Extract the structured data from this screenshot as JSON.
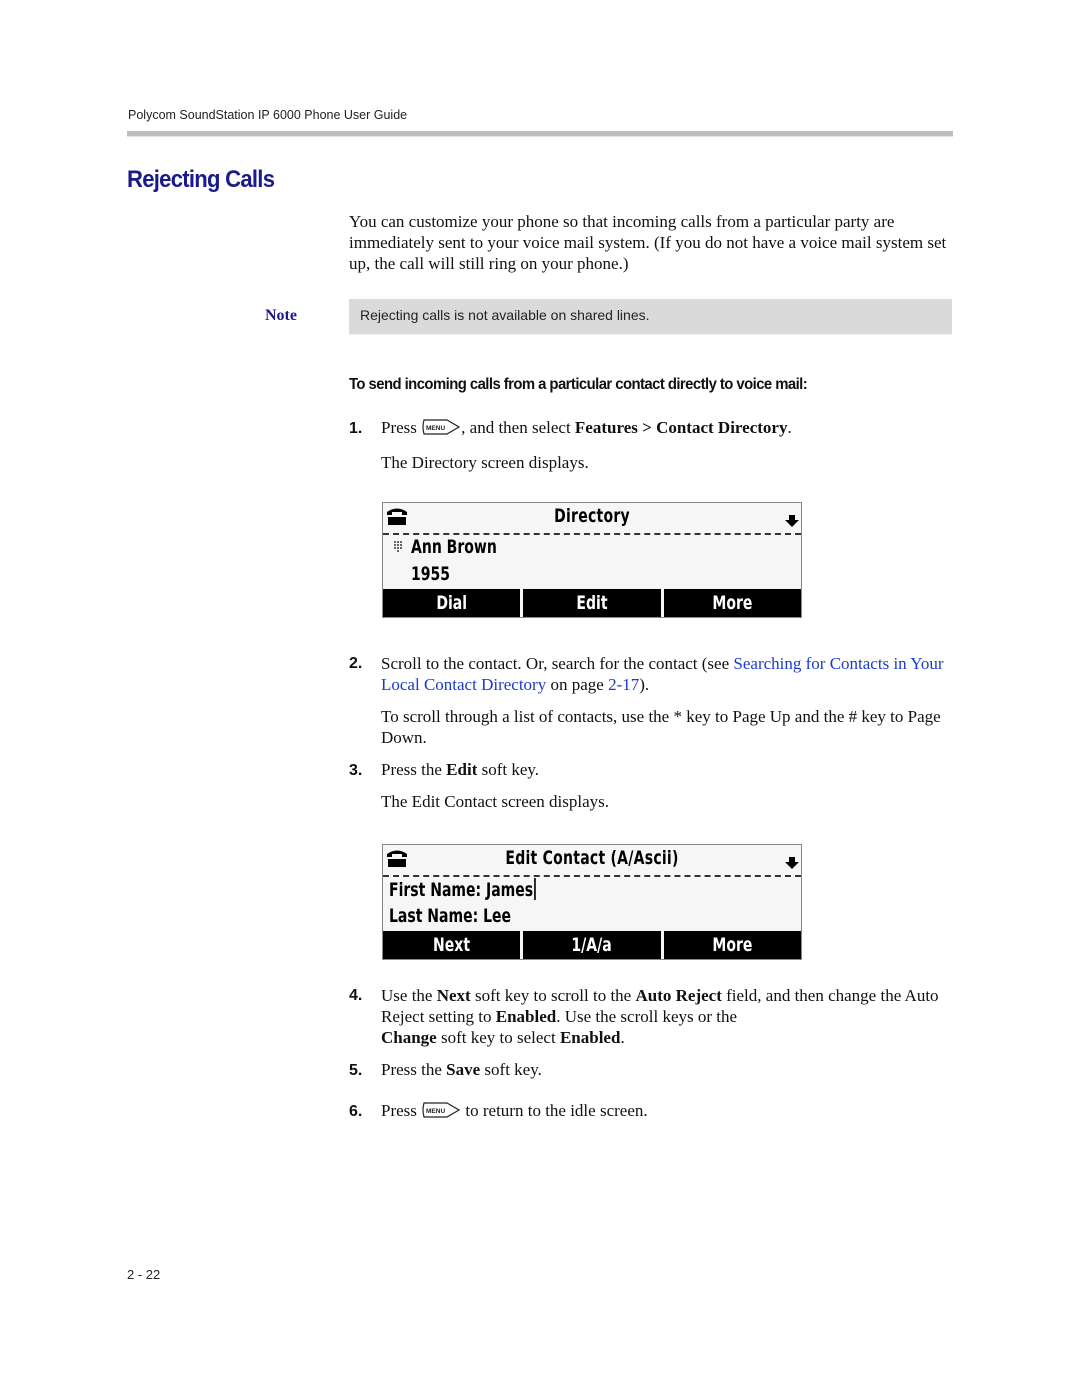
{
  "header": {
    "running_title": "Polycom SoundStation IP 6000 Phone User Guide"
  },
  "section": {
    "title": "Rejecting Calls"
  },
  "intro": "You can customize your phone so that incoming calls from a particular party are immediately sent to your voice mail system. (If you do not have a voice mail system set up, the call will still ring on your phone.)",
  "note": {
    "label": "Note",
    "text": "Rejecting calls is not available on shared lines."
  },
  "procedure": {
    "heading": "To send incoming calls from a particular contact directly to voice mail:",
    "steps": [
      {
        "num": "1.",
        "press": "Press",
        "after_key": ", and then select ",
        "features": "Features",
        "sep": " > ",
        "contact_dir": "Contact Directory",
        "end": ".",
        "result": "The Directory screen displays."
      },
      {
        "num": "2.",
        "text_a": "Scroll to the contact. Or, search for the contact (see ",
        "link": "Searching for Contacts in Your Local Contact Directory",
        "text_b": " on page ",
        "page_link": "2-17",
        "text_c": ").",
        "sub": "To scroll through a list of contacts, use the * key to Page Up and the # key to Page Down."
      },
      {
        "num": "3.",
        "text_a": "Press the ",
        "bold": "Edit",
        "text_b": " soft key.",
        "result": "The Edit Contact screen displays."
      },
      {
        "num": "4.",
        "t1": "Use the ",
        "b1": "Next",
        "t2": " soft key to scroll to the ",
        "b2": "Auto Reject",
        "t3": " field, and then change the Auto Reject setting to ",
        "b3": "Enabled",
        "t4": ". Use the scroll keys or the ",
        "b4": "Change",
        "t5": " soft key to select ",
        "b5": "Enabled",
        "t6": "."
      },
      {
        "num": "5.",
        "text_a": "Press the ",
        "bold": "Save",
        "text_b": " soft key."
      },
      {
        "num": "6.",
        "press": "Press",
        "after_key": " to return to the idle screen."
      }
    ],
    "menu_key_label": "MENU"
  },
  "directory_screen": {
    "title": "Directory",
    "name": "Ann Brown",
    "number": "1955",
    "softkeys": [
      "Dial",
      "Edit",
      "More"
    ]
  },
  "edit_screen": {
    "title": "Edit Contact (A/Ascii)",
    "first_name": "First Name: James",
    "last_name": "Last Name: Lee",
    "softkeys": [
      "Next",
      "1/A/a",
      "More"
    ]
  },
  "footer": {
    "page_number": "2 - 22"
  }
}
